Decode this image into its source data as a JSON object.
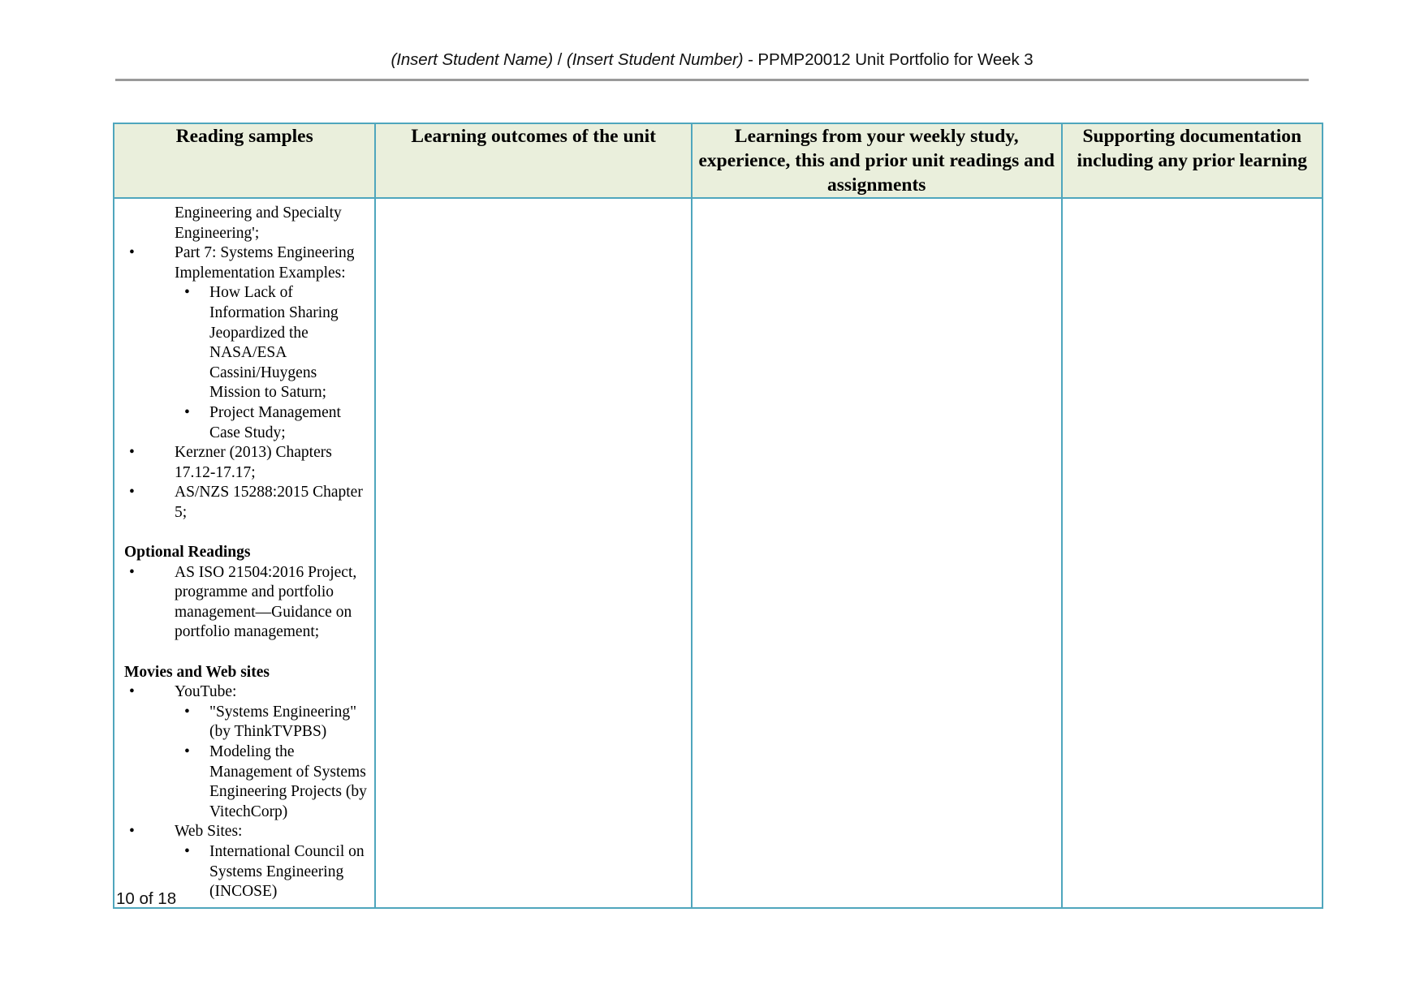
{
  "document": {
    "header": {
      "student_name_placeholder": "(Insert Student Name)",
      "separator": " / ",
      "student_number_placeholder": "(Insert Student Number)",
      "title_suffix": " - PPMP20012 Unit Portfolio for Week 3",
      "full_text": "(Insert Student Name) / (Insert Student Number) - PPMP20012 Unit Portfolio for Week 3"
    },
    "footer": {
      "page_label": "10 of 18"
    }
  },
  "table": {
    "headers": [
      "Reading samples",
      "Learning outcomes of the unit",
      "Learnings from your weekly study, experience, this and prior unit readings and assignments",
      "Supporting documentation including any prior learning"
    ],
    "reading_samples": {
      "continuation_lines": "Engineering and Specialty Engineering';",
      "items": [
        {
          "text": "Part 7: Systems Engineering Implementation Examples:",
          "children": [
            "How Lack of Information Sharing Jeopardized the NASA/ESA Cassini/Huygens Mission to Saturn;",
            "Project Management Case Study;"
          ]
        },
        {
          "text": "Kerzner (2013) Chapters 17.12-17.17;",
          "children": []
        },
        {
          "text": "AS/NZS 15288:2015 Chapter 5;",
          "children": []
        }
      ],
      "optional_readings_heading": "Optional Readings",
      "optional_readings_items": [
        "AS ISO 21504:2016 Project, programme and portfolio management—Guidance on portfolio management;"
      ],
      "movies_heading": "Movies and Web sites",
      "movies_items": [
        {
          "text": "YouTube:",
          "children": [
            "\"Systems Engineering\" (by ThinkTVPBS)",
            "Modeling the Management of Systems Engineering Projects (by VitechCorp)"
          ]
        },
        {
          "text": "Web Sites:",
          "children": [
            "International Council on Systems Engineering (INCOSE)"
          ]
        }
      ]
    },
    "learning_outcomes_content": "",
    "learnings_content": "",
    "supporting_docs_content": ""
  },
  "colors": {
    "header_fill": "#eaefdc",
    "border_teal": "#4fa6bd",
    "rule_gray": "#9a9a9a",
    "text": "#000000"
  },
  "bullet_glyph": "•"
}
